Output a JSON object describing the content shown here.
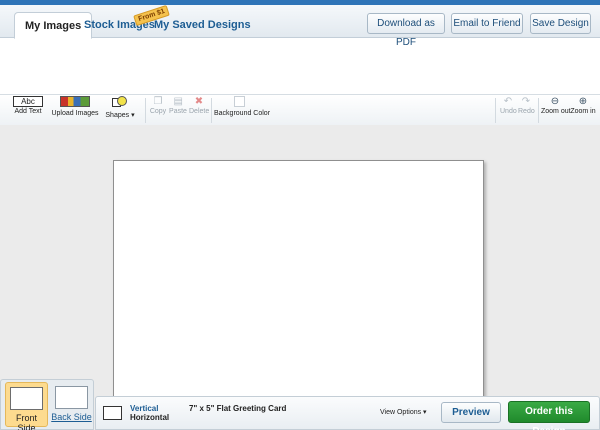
{
  "tabs": {
    "my_images": "My Images",
    "stock_images": "Stock Images",
    "stock_badge": "From $1",
    "saved_designs": "My Saved Designs"
  },
  "header_buttons": {
    "download_pdf": "Download as PDF",
    "email_friend": "Email to Friend",
    "save_design": "Save Design"
  },
  "toolbar": {
    "add_text_icon": "Abc",
    "add_text": "Add Text",
    "upload_images": "Upload Images",
    "shapes": "Shapes ▾",
    "copy": "Copy",
    "paste": "Paste",
    "delete": "Delete",
    "background_color": "Background Color",
    "undo": "Undo",
    "redo": "Redo",
    "zoom_out": "Zoom out",
    "zoom_in": "Zoom in"
  },
  "sides": {
    "front": "Front Side",
    "back": "Back Side"
  },
  "orientation": {
    "vertical": "Vertical",
    "horizontal": "Horizontal"
  },
  "product_name": "7\" x 5\" Flat Greeting Card",
  "view_options": "View Options ▾",
  "actions": {
    "preview": "Preview",
    "order": "Order this Design"
  },
  "colors": {
    "accent_blue": "#2f74b8",
    "order_green": "#2a9a36",
    "active_side": "#fddb8f"
  }
}
